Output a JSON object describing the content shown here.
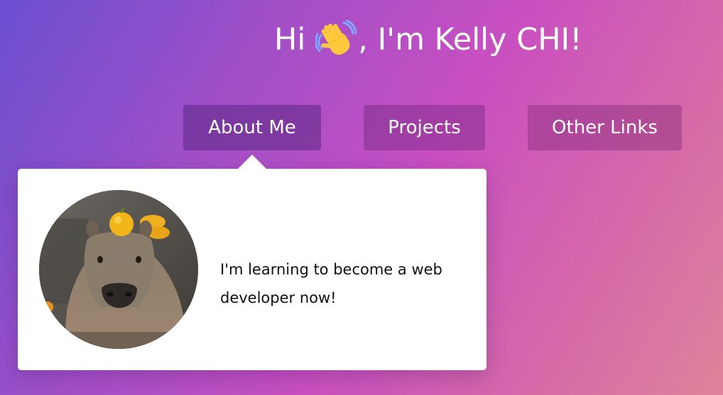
{
  "header": {
    "greeting_prefix": "Hi",
    "wave_icon": "waving-hand-icon",
    "greeting_suffix": ", I'm Kelly CHI!"
  },
  "nav": {
    "buttons": [
      {
        "label": "About Me"
      },
      {
        "label": "Projects"
      },
      {
        "label": "Other Links"
      }
    ]
  },
  "about": {
    "avatar_icon": "capybara-avatar",
    "bio": "I'm learning to become a web developer now!"
  },
  "colors": {
    "gradient_start": "#6a4fd0",
    "gradient_mid": "#c84fc1",
    "gradient_end": "#e0829a",
    "text_light": "#ffffff",
    "card_bg": "#ffffff"
  }
}
